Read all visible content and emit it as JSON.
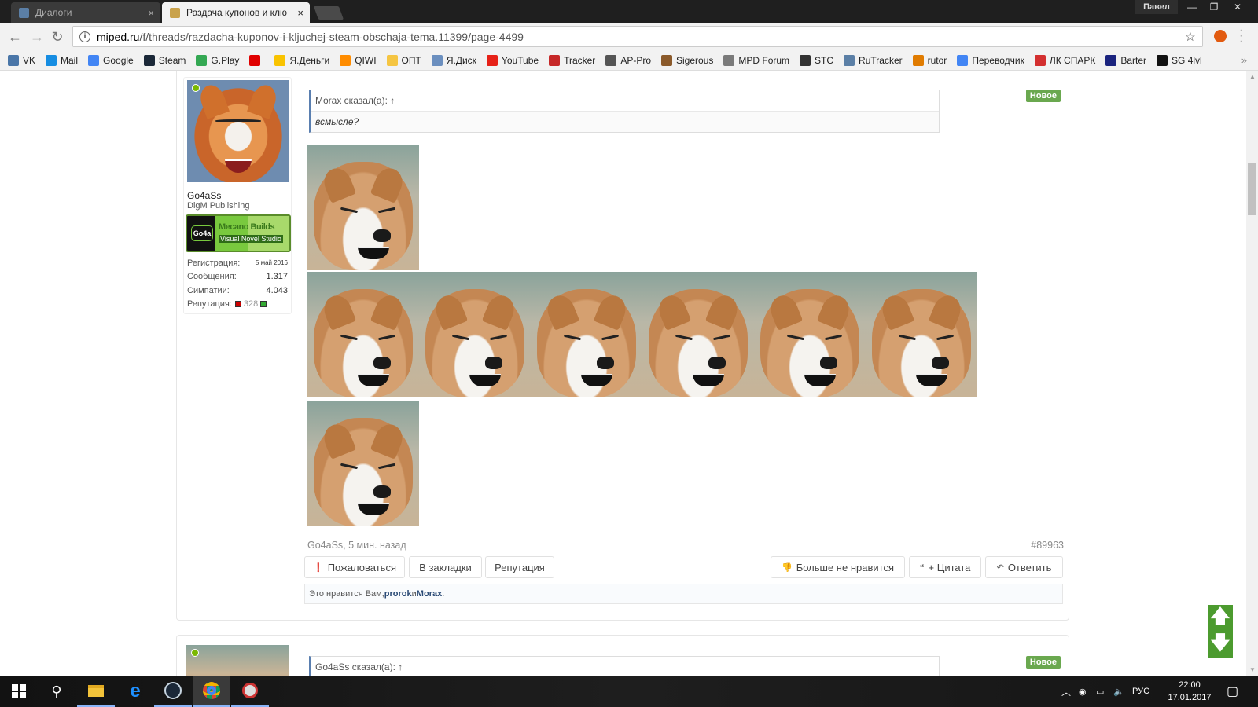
{
  "browser": {
    "tabs": [
      {
        "label": "Диалоги",
        "active": false
      },
      {
        "label": "Раздача купонов и клю",
        "active": true
      }
    ],
    "profile": "Павел",
    "url_host": "miped.ru",
    "url_path": "/f/threads/razdacha-kuponov-i-kljuchej-steam-obschaja-tema.11399/page-4499",
    "bookmarks": [
      {
        "label": "VK",
        "color": "#4a76a8"
      },
      {
        "label": "Mail",
        "color": "#168de2"
      },
      {
        "label": "Google",
        "color": "#4285f4"
      },
      {
        "label": "Steam",
        "color": "#1b2838"
      },
      {
        "label": "G.Play",
        "color": "#34a853"
      },
      {
        "label": "",
        "color": "#e00000"
      },
      {
        "label": "Я.Деньги",
        "color": "#f9c300"
      },
      {
        "label": "QIWI",
        "color": "#ff8c00"
      },
      {
        "label": "ОПТ",
        "color": "#f5c542"
      },
      {
        "label": "Я.Диск",
        "color": "#6b8fbf"
      },
      {
        "label": "YouTube",
        "color": "#e62117"
      },
      {
        "label": "Tracker",
        "color": "#c62828"
      },
      {
        "label": "AP-Pro",
        "color": "#555555"
      },
      {
        "label": "Sigerous",
        "color": "#8b5a2b"
      },
      {
        "label": "MPD Forum",
        "color": "#7a7a7a"
      },
      {
        "label": "STC",
        "color": "#333333"
      },
      {
        "label": "RuTracker",
        "color": "#5b7fa6"
      },
      {
        "label": "rutor",
        "color": "#e07b00"
      },
      {
        "label": "Переводчик",
        "color": "#4285f4"
      },
      {
        "label": "ЛК СПАРК",
        "color": "#d32f2f"
      },
      {
        "label": "Barter",
        "color": "#1a237e"
      },
      {
        "label": "SG 4lvl",
        "color": "#111111"
      }
    ]
  },
  "post": {
    "user": {
      "name": "Go4aSs",
      "title": "DigM Publishing",
      "banner_logo": "Go4a",
      "banner_title": "Mecano Builds",
      "banner_sub": "Visual Novel Studio",
      "stats": [
        {
          "label": "Регистрация:",
          "value": "5 май 2016"
        },
        {
          "label": "Сообщения:",
          "value": "1.317"
        },
        {
          "label": "Симпатии:",
          "value": "4.043"
        }
      ],
      "rep_label": "Репутация:",
      "rep_value": "328"
    },
    "badge": "Новое",
    "quote_author": "Morax сказал(а): ↑",
    "quote_text": "всмысле?",
    "meta": "Go4aSs, 5 мин. назад",
    "number": "#89963",
    "buttons_left": [
      "Пожаловаться",
      "В закладки",
      "Репутация"
    ],
    "buttons_right": [
      "Больше не нравится",
      "+ Цитата",
      "Ответить"
    ],
    "likes_prefix": "Это нравится Вам, ",
    "likes_user1": "prorok",
    "likes_and": " и ",
    "likes_user2": "Morax",
    "likes_suffix": "."
  },
  "post2": {
    "badge": "Новое",
    "quote_author": "Go4aSs сказал(а): ↑"
  },
  "taskbar": {
    "lang": "РУС",
    "time": "22:00",
    "date": "17.01.2017"
  },
  "colors": {
    "new_badge": "#6aa84f",
    "scroll_nav": "#4c9b2f",
    "quote_border": "#5a7fb0"
  }
}
